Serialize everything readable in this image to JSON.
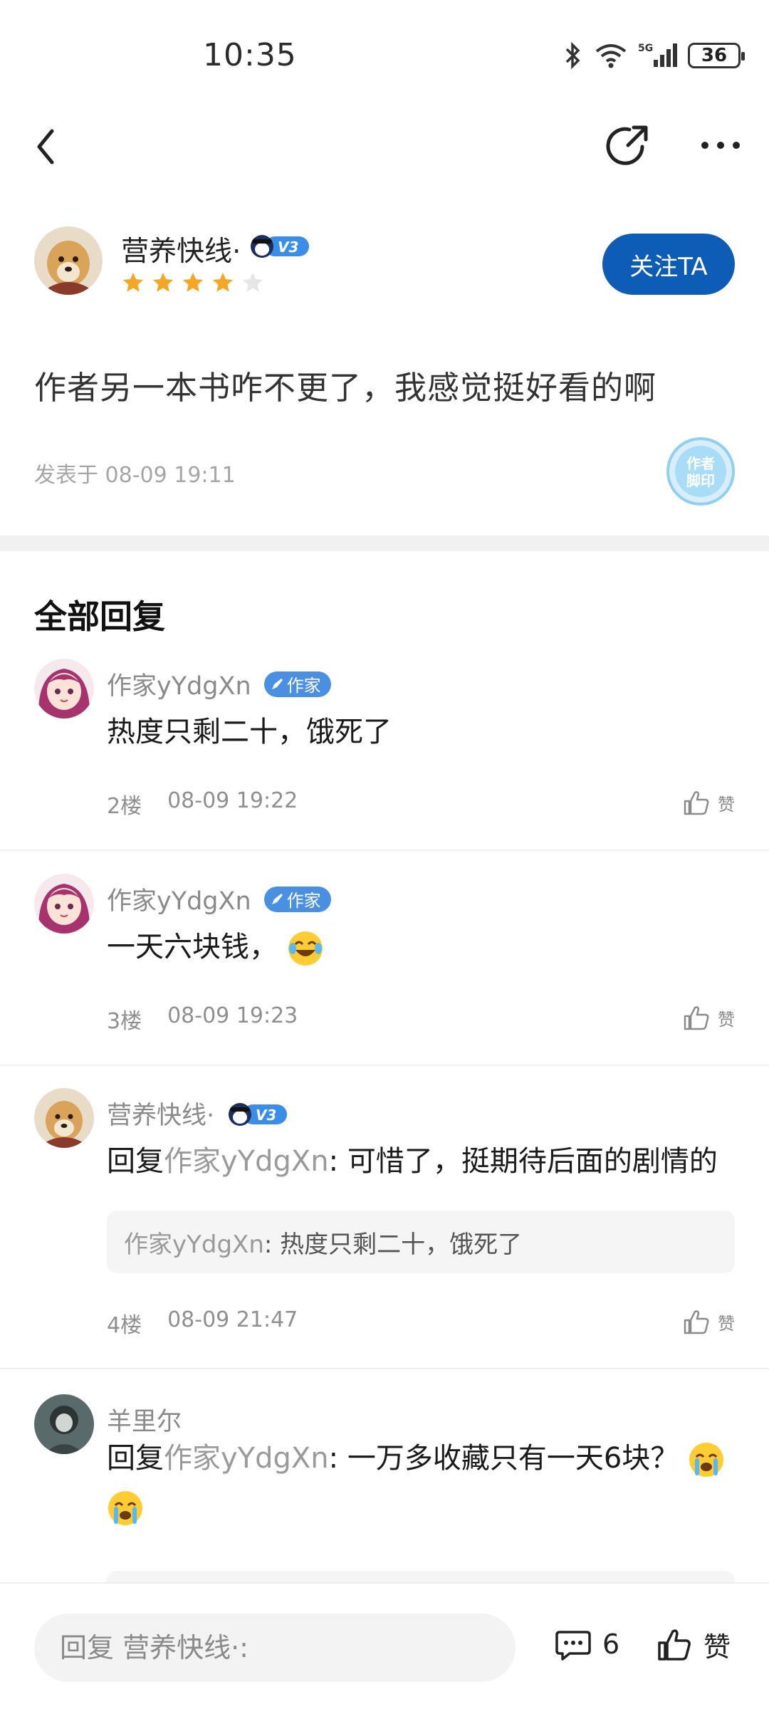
{
  "status_bar": {
    "time": "10:35",
    "network": "5G",
    "battery": "36",
    "icons": [
      "bluetooth-icon",
      "wifi-icon",
      "signal-icon",
      "battery-icon"
    ]
  },
  "nav": {
    "icons": [
      "back-icon",
      "share-icon",
      "more-icon"
    ]
  },
  "author": {
    "name": "营养快线·",
    "level_badge": "V3",
    "rating": 4,
    "rating_max": 5,
    "follow_label": "关注TA"
  },
  "post": {
    "text": "作者另一本书咋不更了，我感觉挺好看的啊",
    "meta": "发表于 08-09 19:11",
    "stamp": "作者脚印"
  },
  "replies_title": "全部回复",
  "replies": [
    {
      "name": "作家yYdgXn",
      "badge": "作家",
      "text": "热度只剩二十，饿死了",
      "floor": "2楼",
      "time": "08-09 19:22",
      "like_label": "赞"
    },
    {
      "name": "作家yYdgXn",
      "badge": "作家",
      "text": "一天六块钱，",
      "emoji": "laugh-cry-emoji",
      "floor": "3楼",
      "time": "08-09 19:23",
      "like_label": "赞"
    },
    {
      "name": "营养快线·",
      "badge": "V3",
      "reply_prefix": "回复",
      "reply_to": "作家yYdgXn",
      "text": ": 可惜了，挺期待后面的剧情的",
      "quote_author": "作家yYdgXn",
      "quote_text": ": 热度只剩二十，饿死了",
      "floor": "4楼",
      "time": "08-09 21:47",
      "like_label": "赞"
    },
    {
      "name": "羊里尔",
      "reply_prefix": "回复",
      "reply_to": "作家yYdgXn",
      "text": ": 一万多收藏只有一天6块？",
      "emoji": "crying-emoji"
    }
  ],
  "bottom_bar": {
    "input_placeholder": "回复 营养快线·:",
    "comment_count": "6",
    "like_label": "赞"
  },
  "colors": {
    "accent": "#0d5cb6",
    "star": "#f5a623",
    "writer_badge": "#4a90e2"
  }
}
